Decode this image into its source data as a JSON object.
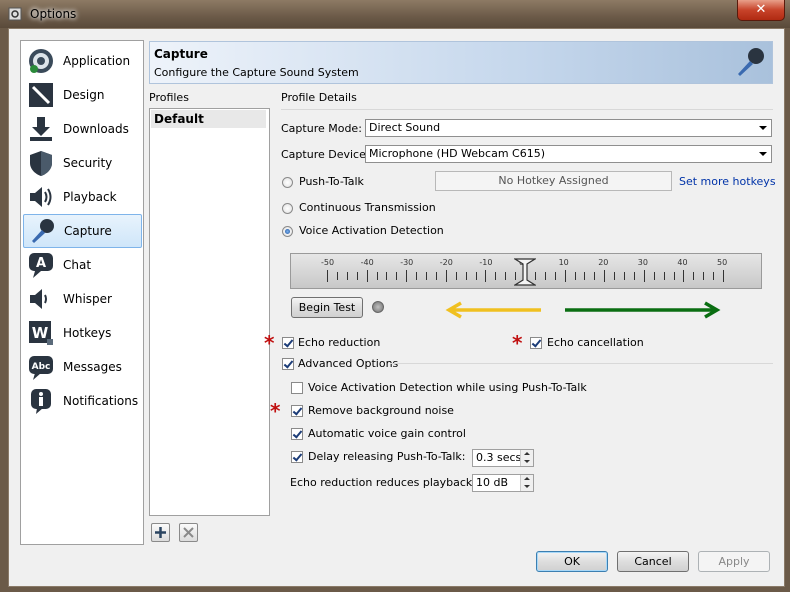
{
  "window": {
    "title": "Options",
    "close_glyph": "✕"
  },
  "sidebar": {
    "items": [
      {
        "label": "Application",
        "icon": "teamspeak-logo-icon"
      },
      {
        "label": "Design",
        "icon": "design-pen-icon"
      },
      {
        "label": "Downloads",
        "icon": "download-arrow-icon"
      },
      {
        "label": "Security",
        "icon": "shield-icon"
      },
      {
        "label": "Playback",
        "icon": "speaker-icon"
      },
      {
        "label": "Capture",
        "icon": "microphone-icon",
        "selected": true
      },
      {
        "label": "Chat",
        "icon": "chat-bubble-icon"
      },
      {
        "label": "Whisper",
        "icon": "whisper-speaker-icon"
      },
      {
        "label": "Hotkeys",
        "icon": "hotkey-w-icon"
      },
      {
        "label": "Messages",
        "icon": "abc-bubble-icon"
      },
      {
        "label": "Notifications",
        "icon": "info-bubble-icon"
      }
    ]
  },
  "header": {
    "title": "Capture",
    "subtitle": "Configure the Capture Sound System"
  },
  "profiles": {
    "label": "Profiles",
    "items": [
      "Default"
    ]
  },
  "details": {
    "label": "Profile Details",
    "capture_mode_label": "Capture Mode:",
    "capture_mode_value": "Direct Sound",
    "capture_device_label": "Capture Device:",
    "capture_device_value": "Microphone (HD Webcam C615)",
    "ptt_label": "Push-To-Talk",
    "hotkey_text": "No Hotkey Assigned",
    "more_hotkeys": "Set more hotkeys",
    "continuous_label": "Continuous Transmission",
    "vad_label": "Voice Activation Detection",
    "selected_mode": "Voice Activation Detection",
    "slider": {
      "min": -50,
      "max": 50,
      "value": 0,
      "labels": [
        "-50",
        "-40",
        "-30",
        "-20",
        "-10",
        "0",
        "10",
        "20",
        "30",
        "40",
        "50"
      ]
    },
    "begin_test": "Begin Test",
    "echo_reduction": {
      "label": "Echo reduction",
      "checked": true
    },
    "echo_cancellation": {
      "label": "Echo cancellation",
      "checked": true
    },
    "advanced": {
      "label": "Advanced Options",
      "checked": true
    },
    "vad_ptt": {
      "label": "Voice Activation Detection while using Push-To-Talk",
      "checked": false
    },
    "remove_noise": {
      "label": "Remove background noise",
      "checked": true
    },
    "agc": {
      "label": "Automatic voice gain control",
      "checked": true
    },
    "delay_ptt": {
      "label": "Delay releasing Push-To-Talk:",
      "checked": true,
      "value": "0.3 secs"
    },
    "echo_playback_label": "Echo reduction reduces playback by:",
    "echo_playback_value": "10 dB",
    "star_glyph": "*"
  },
  "footer": {
    "ok": "OK",
    "cancel": "Cancel",
    "apply": "Apply"
  },
  "colors": {
    "arrow_left": "#f0c020",
    "arrow_right": "#0a6e12",
    "star": "#c01010"
  }
}
